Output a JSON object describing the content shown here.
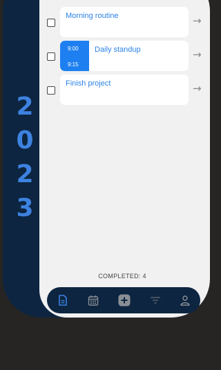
{
  "year": [
    "2",
    "0",
    "2",
    "3"
  ],
  "tasks": [
    {
      "title": "Morning routine"
    },
    {
      "title": "Daily standup",
      "start": "9:00",
      "end": "9:15"
    },
    {
      "title": "Finish project"
    }
  ],
  "arrow_glyph": "→",
  "footer": {
    "completed_label": "COMPLETED: 4"
  },
  "nav": {
    "items": [
      "document-icon",
      "calendar-icon",
      "add-icon",
      "filter-icon",
      "profile-icon"
    ],
    "active": "document-icon"
  },
  "colors": {
    "background": "#262523",
    "phone": "#0d2540",
    "accent": "#2b82e8",
    "panel": "#f1f1f1"
  }
}
